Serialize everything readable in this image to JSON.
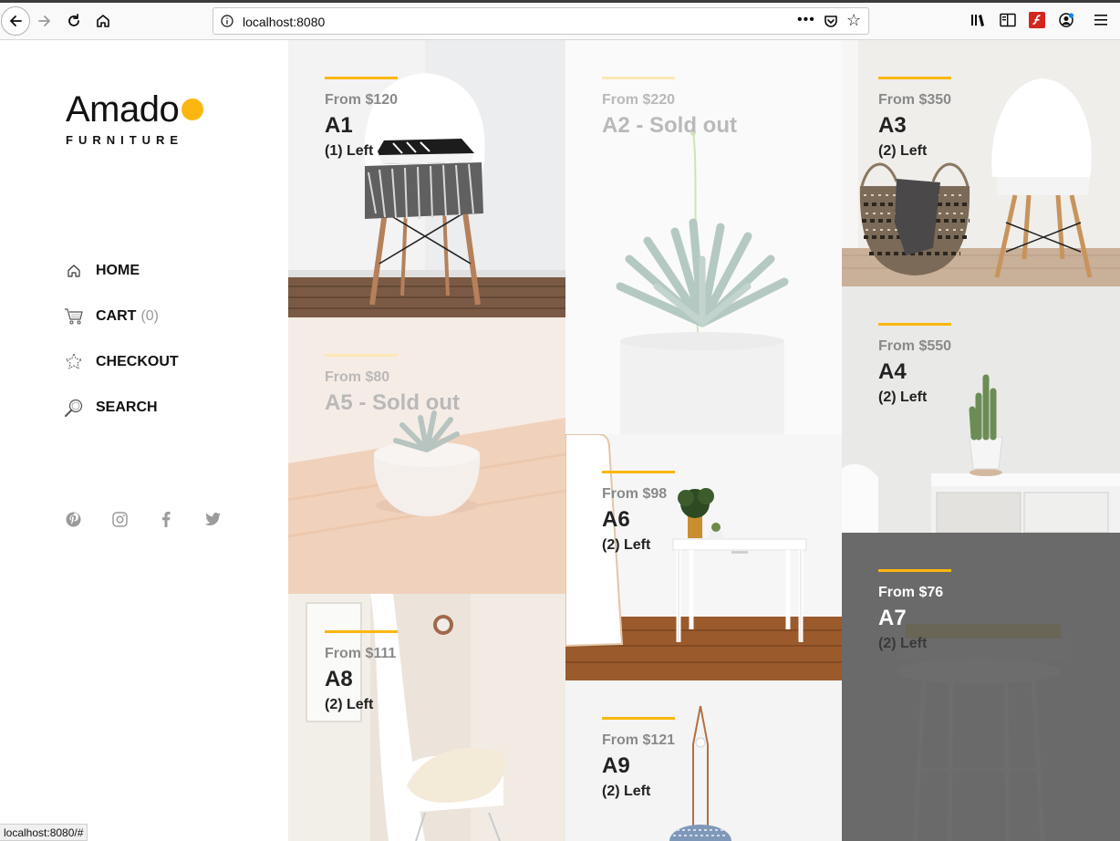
{
  "browser": {
    "url": "localhost:8080",
    "status_url": "localhost:8080/#"
  },
  "brand": {
    "name": "Amado",
    "tagline": "FURNITURE",
    "accent_color": "#fbb710"
  },
  "menu": [
    {
      "label": "HOME",
      "icon": "home-icon"
    },
    {
      "label": "CART",
      "count": "(0)",
      "icon": "cart-icon"
    },
    {
      "label": "CHECKOUT",
      "icon": "star-badge-icon"
    },
    {
      "label": "SEARCH",
      "icon": "search-icon"
    }
  ],
  "social": [
    "pinterest-icon",
    "instagram-icon",
    "facebook-icon",
    "twitter-icon"
  ],
  "products": {
    "a1": {
      "price": "From $120",
      "name": "A1",
      "left": "(1) Left"
    },
    "a2": {
      "price": "From $220",
      "name": "A2 - Sold out"
    },
    "a3": {
      "price": "From $350",
      "name": "A3",
      "left": "(2) Left"
    },
    "a4": {
      "price": "From $550",
      "name": "A4",
      "left": "(2) Left"
    },
    "a5": {
      "price": "From $80",
      "name": "A5 - Sold out"
    },
    "a6": {
      "price": "From $98",
      "name": "A6",
      "left": "(2) Left"
    },
    "a7": {
      "price": "From $76",
      "name": "A7",
      "left": "(2) Left"
    },
    "a8": {
      "price": "From $111",
      "name": "A8",
      "left": "(2) Left"
    },
    "a9": {
      "price": "From $121",
      "name": "A9",
      "left": "(2) Left"
    }
  }
}
